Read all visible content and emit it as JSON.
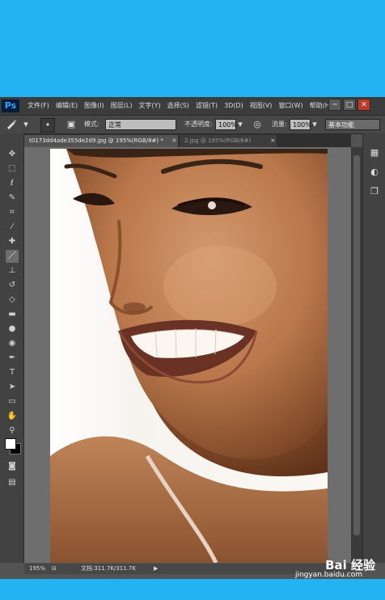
{
  "app": {
    "logo": "Ps"
  },
  "menubar": {
    "items": [
      "文件(F)",
      "编辑(E)",
      "图像(I)",
      "图层(L)",
      "文字(Y)",
      "选择(S)",
      "滤镜(T)",
      "3D(D)",
      "视图(V)",
      "窗口(W)",
      "帮助(H)"
    ]
  },
  "window_controls": {
    "minimize": "─",
    "restore": "□",
    "close": "✕"
  },
  "options": {
    "mode_label": "模式:",
    "mode_value": "正常",
    "opacity_label": "不透明度:",
    "opacity_value": "100%",
    "flow_label": "流量:",
    "flow_value": "100%",
    "workspace": "基本功能"
  },
  "tabs": [
    {
      "label": "t0173dd4ade355de2d9.jpg @ 195%(RGB/8#) *",
      "close": "×"
    },
    {
      "label": "2.jpg @ 195%(RGB/8#)",
      "close": "×"
    }
  ],
  "status": {
    "zoom": "195%",
    "doc_info": "文档:311.7K/311.7K",
    "arrow": "▶"
  },
  "watermark": {
    "brand": "Bai 经验",
    "url": "jingyan.baidu.com"
  },
  "colors": {
    "page_bg": "#24b3f2",
    "chrome": "#535353",
    "foreground_swatch": "#ffffff",
    "background_swatch": "#000000"
  },
  "icons": [
    "brush-icon",
    "move-icon",
    "marquee-icon",
    "lasso-icon",
    "quick-select-icon",
    "crop-icon",
    "eyedropper-icon",
    "healing-icon",
    "brush-tool-icon",
    "clone-stamp-icon",
    "history-brush-icon",
    "eraser-icon",
    "gradient-icon",
    "blur-icon",
    "dodge-icon",
    "pen-icon",
    "type-icon",
    "path-select-icon",
    "rectangle-icon",
    "hand-icon",
    "zoom-icon",
    "quick-mask-icon",
    "screen-mode-icon"
  ]
}
